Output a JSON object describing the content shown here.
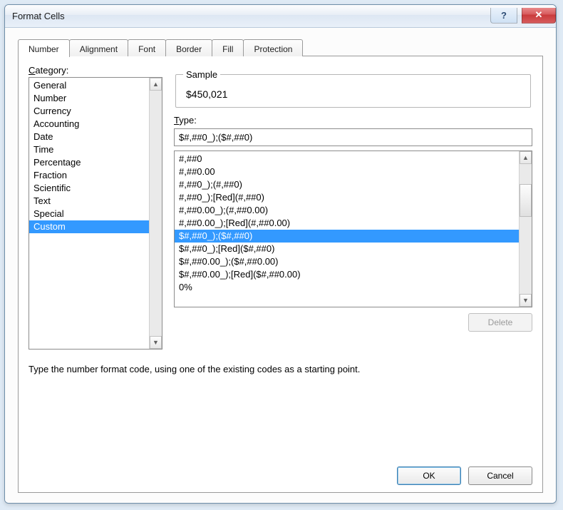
{
  "window": {
    "title": "Format Cells"
  },
  "tabs": [
    {
      "label": "Number"
    },
    {
      "label": "Alignment"
    },
    {
      "label": "Font"
    },
    {
      "label": "Border"
    },
    {
      "label": "Fill"
    },
    {
      "label": "Protection"
    }
  ],
  "category": {
    "label_pre": "C",
    "label_rest": "ategory:",
    "items": [
      "General",
      "Number",
      "Currency",
      "Accounting",
      "Date",
      "Time",
      "Percentage",
      "Fraction",
      "Scientific",
      "Text",
      "Special",
      "Custom"
    ],
    "selected_index": 11
  },
  "sample": {
    "legend": "Sample",
    "value": "$450,021"
  },
  "type": {
    "label_pre": "T",
    "label_rest": "ype:",
    "value": "$#,##0_);($#,##0)"
  },
  "formats": {
    "items": [
      "#,##0",
      "#,##0.00",
      "#,##0_);(#,##0)",
      "#,##0_);[Red](#,##0)",
      "#,##0.00_);(#,##0.00)",
      "#,##0.00_);[Red](#,##0.00)",
      "$#,##0_);($#,##0)",
      "$#,##0_);[Red]($#,##0)",
      "$#,##0.00_);($#,##0.00)",
      "$#,##0.00_);[Red]($#,##0.00)",
      "0%"
    ],
    "selected_index": 6
  },
  "help_text": "Type the number format code, using one of the existing codes as a starting point.",
  "buttons": {
    "delete": "Delete",
    "ok": "OK",
    "cancel": "Cancel"
  }
}
